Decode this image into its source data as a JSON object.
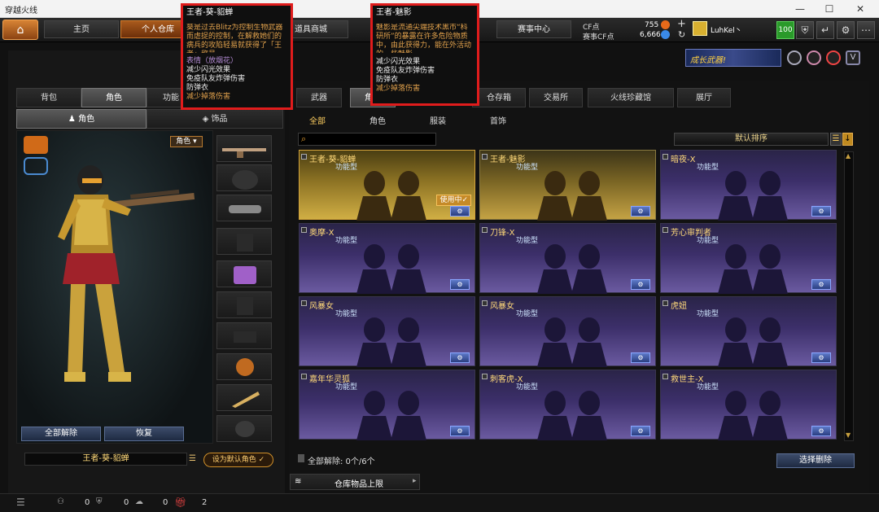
{
  "window": {
    "title": "穿越火线",
    "minimize": "—",
    "maximize": "☐",
    "close": "✕"
  },
  "nav": {
    "home_icon": "home-icon",
    "items": [
      "主页",
      "个人仓库",
      "道具商城",
      "赛事中心"
    ]
  },
  "currency": {
    "cf_label": "CF点",
    "cf_value": "755",
    "match_label": "赛事CF点",
    "match_value": "6,666",
    "plus": "+",
    "refresh": "↻"
  },
  "user": {
    "name": "LuhKel丶",
    "level": "100"
  },
  "banner": {
    "text": "成长武器!"
  },
  "left": {
    "main_tabs": [
      "背包",
      "角色",
      "功能"
    ],
    "sub_tabs": [
      "角色",
      "饰品"
    ],
    "role_badge": "角色",
    "unequip_all": "全部解除",
    "restore": "恢复",
    "current_name": "王者-葵-貂蝉",
    "set_default": "设为默认角色"
  },
  "right": {
    "tabs": [
      "武器",
      "角色",
      "仓存箱",
      "交易所",
      "火线珍藏馆",
      "展厅"
    ],
    "filters": [
      "全部",
      "角色",
      "服装",
      "首饰"
    ],
    "search_placeholder": "",
    "sort_label": "默认排序",
    "footer_status": "全部解除: 0个/6个",
    "select_delete": "选择删除",
    "capacity": "仓库物品上限"
  },
  "cards": [
    {
      "name": "王者-葵-貂蝉",
      "type": "功能型",
      "style": "sel",
      "in_use": "使用中✓"
    },
    {
      "name": "王者-魅影",
      "type": "功能型",
      "style": "gold",
      "in_use": ""
    },
    {
      "name": "暗夜-X",
      "type": "功能型",
      "style": "",
      "in_use": ""
    },
    {
      "name": "奥摩-X",
      "type": "功能型",
      "style": "",
      "in_use": ""
    },
    {
      "name": "刀锋-X",
      "type": "功能型",
      "style": "",
      "in_use": ""
    },
    {
      "name": "芳心审判者",
      "type": "功能型",
      "style": "",
      "in_use": ""
    },
    {
      "name": "风暴女",
      "type": "功能型",
      "style": "",
      "in_use": ""
    },
    {
      "name": "风暴女",
      "type": "功能型",
      "style": "",
      "in_use": ""
    },
    {
      "name": "虎妞",
      "type": "功能型",
      "style": "",
      "in_use": ""
    },
    {
      "name": "嘉年华灵狐",
      "type": "功能型",
      "style": "",
      "in_use": ""
    },
    {
      "name": "刺客虎-X",
      "type": "功能型",
      "style": "",
      "in_use": ""
    },
    {
      "name": "救世主-X",
      "type": "功能型",
      "style": "",
      "in_use": ""
    }
  ],
  "tooltip1": {
    "title": "王者-葵-貂蝉",
    "desc": "葵是过去Blitz为控制生物武器而虐捉的控制，在解救她们的病兵的攻陷轻易就获得了「王者」称号。",
    "emote": "表情（放烟花）",
    "effects": [
      "减少闪光效果",
      "免疫队友炸弹伤害",
      "防弹衣",
      "减少掉落伤害"
    ]
  },
  "tooltip2": {
    "title": "王者-魅影",
    "desc": "魅影是流通尖端技术黑市“科研所”的暴露在许多危险物质中，由此获得力，能在外活动的一些魅影。",
    "effects": [
      "减少闪光效果",
      "免疫队友炸弹伤害",
      "防弹衣",
      "减少掉落伤害"
    ]
  },
  "statusbar": {
    "counts": [
      "0",
      "0",
      "0"
    ],
    "badge": "2"
  }
}
